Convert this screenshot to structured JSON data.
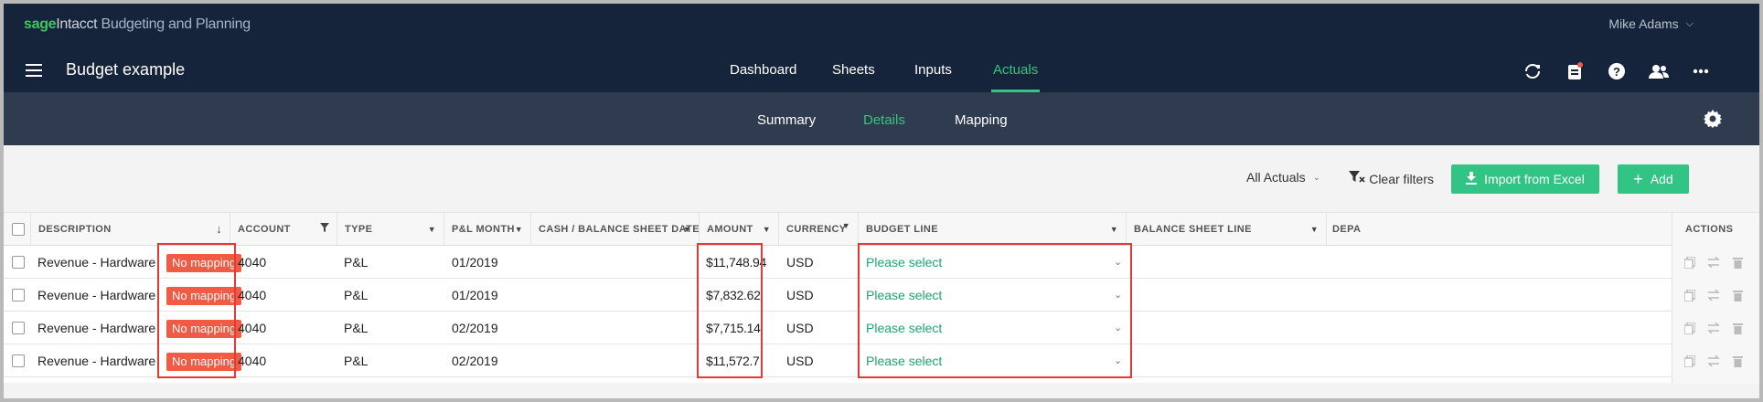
{
  "brand": {
    "sage": "sage",
    "intacct": "Intacct",
    "product": "Budgeting and Planning"
  },
  "user": {
    "name": "Mike Adams"
  },
  "app": {
    "title": "Budget example"
  },
  "main_nav": [
    {
      "label": "Dashboard",
      "active": false
    },
    {
      "label": "Sheets",
      "active": false
    },
    {
      "label": "Inputs",
      "active": false
    },
    {
      "label": "Actuals",
      "active": true
    }
  ],
  "top_icons": [
    "refresh-icon",
    "clipboard-icon",
    "help-icon",
    "users-icon",
    "more-icon"
  ],
  "sub_nav": [
    {
      "label": "Summary",
      "active": false
    },
    {
      "label": "Details",
      "active": true
    },
    {
      "label": "Mapping",
      "active": false
    }
  ],
  "toolbar": {
    "filter_value": "All Actuals",
    "clear_filters": "Clear filters",
    "import_label": "Import from Excel",
    "add_label": "Add"
  },
  "table": {
    "columns": [
      "DESCRIPTION",
      "ACCOUNT",
      "TYPE",
      "P&L MONTH",
      "CASH / BALANCE SHEET DATE",
      "AMOUNT",
      "CURRENCY",
      "BUDGET LINE",
      "BALANCE SHEET LINE",
      "DEPA",
      "ACTIONS"
    ],
    "rows": [
      {
        "description": "Revenue - Hardware",
        "badge": "No mapping",
        "account": "4040",
        "type": "P&L",
        "pl_month": "01/2019",
        "amount": "$11,748.94",
        "currency": "USD",
        "budget_line": "Please select"
      },
      {
        "description": "Revenue - Hardware",
        "badge": "No mapping",
        "account": "4040",
        "type": "P&L",
        "pl_month": "01/2019",
        "amount": "$7,832.62",
        "currency": "USD",
        "budget_line": "Please select"
      },
      {
        "description": "Revenue - Hardware",
        "badge": "No mapping",
        "account": "4040",
        "type": "P&L",
        "pl_month": "02/2019",
        "amount": "$7,715.14",
        "currency": "USD",
        "budget_line": "Please select"
      },
      {
        "description": "Revenue - Hardware",
        "badge": "No mapping",
        "account": "4040",
        "type": "P&L",
        "pl_month": "02/2019",
        "amount": "$11,572.7",
        "currency": "USD",
        "budget_line": "Please select"
      }
    ]
  },
  "colors": {
    "accent": "#31c77f",
    "header_bg": "#15243a",
    "subbar_bg": "#2f3c4f",
    "badge": "#f15a45",
    "highlight": "#e53935"
  }
}
